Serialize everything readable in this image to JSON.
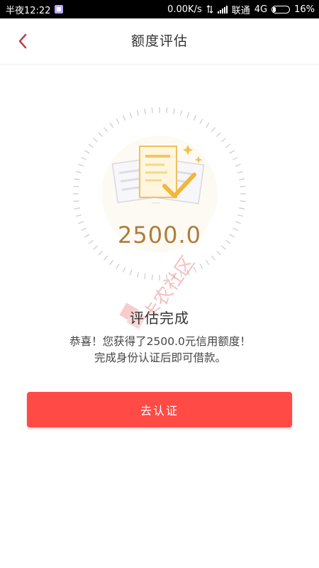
{
  "status_bar": {
    "time": "半夜12:22",
    "network_speed": "0.00K/s",
    "carrier": "联通",
    "network_type": "4G",
    "battery": "16%"
  },
  "nav": {
    "title": "额度评估"
  },
  "result": {
    "amount": "2500.0",
    "status": "评估完成",
    "message": "恭喜！您获得了2500.0元信用额度！完成身份认证后即可借款。"
  },
  "action": {
    "button_label": "去认证"
  },
  "watermark": {
    "text": "卡农社区"
  },
  "colors": {
    "accent": "#ff4a46",
    "amount": "#b07c3c",
    "back_arrow": "#c2424e",
    "tick": "#cfcfcf"
  }
}
